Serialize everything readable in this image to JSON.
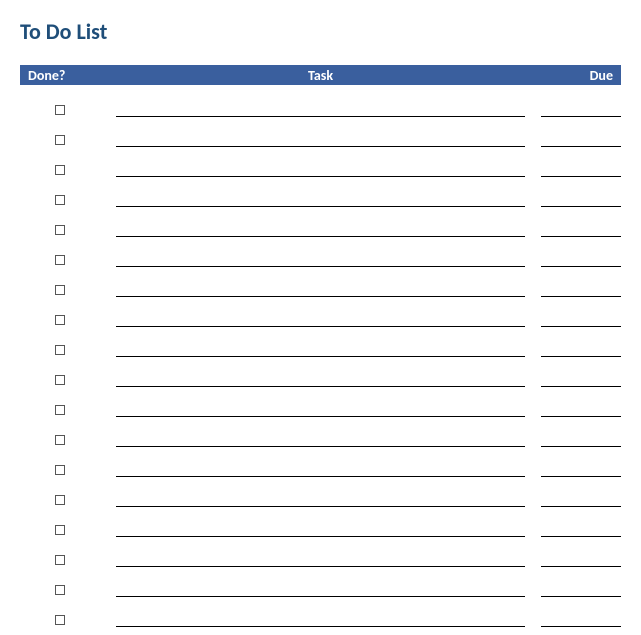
{
  "title": "To Do List",
  "headers": {
    "done": "Done?",
    "task": "Task",
    "due": "Due"
  },
  "rows": [
    {
      "done": false,
      "task": "",
      "due": ""
    },
    {
      "done": false,
      "task": "",
      "due": ""
    },
    {
      "done": false,
      "task": "",
      "due": ""
    },
    {
      "done": false,
      "task": "",
      "due": ""
    },
    {
      "done": false,
      "task": "",
      "due": ""
    },
    {
      "done": false,
      "task": "",
      "due": ""
    },
    {
      "done": false,
      "task": "",
      "due": ""
    },
    {
      "done": false,
      "task": "",
      "due": ""
    },
    {
      "done": false,
      "task": "",
      "due": ""
    },
    {
      "done": false,
      "task": "",
      "due": ""
    },
    {
      "done": false,
      "task": "",
      "due": ""
    },
    {
      "done": false,
      "task": "",
      "due": ""
    },
    {
      "done": false,
      "task": "",
      "due": ""
    },
    {
      "done": false,
      "task": "",
      "due": ""
    },
    {
      "done": false,
      "task": "",
      "due": ""
    },
    {
      "done": false,
      "task": "",
      "due": ""
    },
    {
      "done": false,
      "task": "",
      "due": ""
    },
    {
      "done": false,
      "task": "",
      "due": ""
    }
  ]
}
